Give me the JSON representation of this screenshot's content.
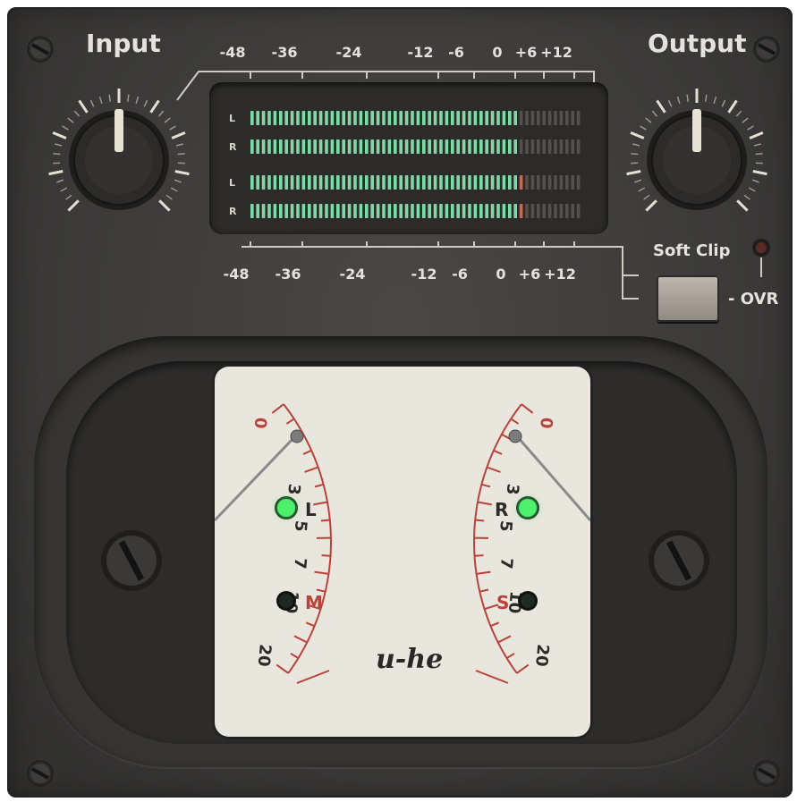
{
  "knobs": {
    "input_label": "Input",
    "output_label": "Output",
    "input_value": 0.5,
    "output_value": 0.5
  },
  "meter": {
    "scale_top": [
      "-48",
      "-36",
      "-24",
      "-12",
      "-6",
      "0",
      "+6",
      "+12"
    ],
    "scale_bottom": [
      "-48",
      "-36",
      "-24",
      "-12",
      "-6",
      "0",
      "+6",
      "+12"
    ],
    "rows": [
      {
        "channel": "L",
        "level_db": -1,
        "peak": false
      },
      {
        "channel": "R",
        "level_db": -1,
        "peak": false
      },
      {
        "channel": "L",
        "level_db": 0,
        "peak": true
      },
      {
        "channel": "R",
        "level_db": 0,
        "peak": true
      }
    ],
    "colors": {
      "segment_on": "#7fd8a8",
      "segment_off": "#555049",
      "peak": "#e0604a"
    }
  },
  "soft_clip": {
    "label": "Soft Clip",
    "ovr_label": "OVR",
    "indicator_on": false
  },
  "vu": {
    "scale_left": [
      "0",
      "3",
      "5",
      "7",
      "10",
      "20"
    ],
    "scale_right": [
      "0",
      "3",
      "5",
      "7",
      "10",
      "20"
    ],
    "leds": {
      "l": "L",
      "r": "R",
      "m": "M",
      "s": "S"
    },
    "l_on": true,
    "r_on": true,
    "m_on": false,
    "s_on": false,
    "brand": "u-he",
    "colors": {
      "scale": "#b9423c",
      "led_on": "#4cf06a",
      "face": "#e9e6dd"
    }
  }
}
